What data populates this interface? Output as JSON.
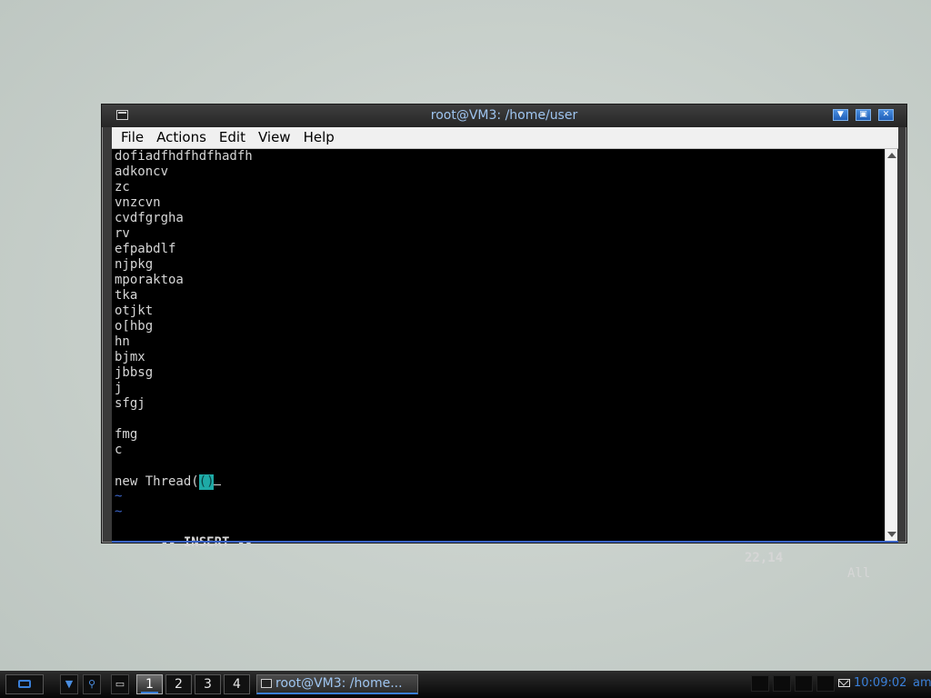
{
  "window": {
    "title": "root@VM3: /home/user",
    "menu": [
      "File",
      "Actions",
      "Edit",
      "View",
      "Help"
    ]
  },
  "terminal": {
    "lines": [
      "dofiadfhdfhdfhadfh",
      "adkoncv",
      "zc",
      "vnzcvn",
      "cvdfgrgha",
      "rv",
      "efpabdlf",
      "njpkg",
      "mporaktoa",
      "tka",
      "otjkt",
      "o[hbg",
      "hn",
      "bjmx",
      "jbbsg",
      "j",
      "sfgj",
      "",
      "fmg",
      "c",
      ""
    ],
    "current_line_prefix": "new Thread(",
    "cursor_char": "()",
    "tildes": [
      "~",
      "~"
    ],
    "mode": "-- INSERT --",
    "position": "22,14",
    "scroll": "All"
  },
  "taskbar": {
    "workspaces": [
      "1",
      "2",
      "3",
      "4"
    ],
    "active_workspace": "1",
    "task_title": "root@VM3: /home...",
    "clock": "10:09:02",
    "ampm": "am"
  },
  "colors": {
    "title_text": "#9ec4ef",
    "accent": "#3a7fd8",
    "cursor_bg": "#1eaaa6",
    "tilde": "#3b64c7"
  }
}
